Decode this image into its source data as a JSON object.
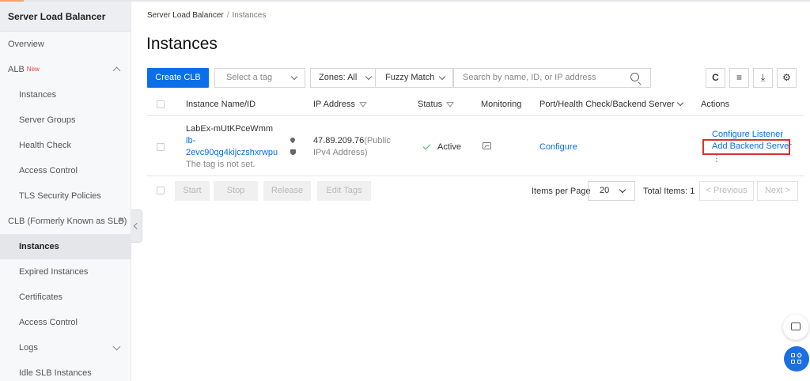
{
  "sidebar": {
    "title": "Server Load Balancer",
    "overview": "Overview",
    "alb": {
      "label": "ALB",
      "badge": "New"
    },
    "alb_items": [
      "Instances",
      "Server Groups",
      "Health Check",
      "Access Control",
      "TLS Security Policies"
    ],
    "clb": {
      "label": "CLB (Formerly Known as SLB)"
    },
    "clb_items": [
      "Instances",
      "Expired Instances",
      "Certificates",
      "Access Control",
      "Logs",
      "Idle SLB Instances"
    ]
  },
  "breadcrumb": {
    "root": "Server Load Balancer",
    "separator": "/",
    "current": "Instances"
  },
  "page": {
    "title": "Instances"
  },
  "toolbar": {
    "create_label": "Create CLB",
    "tag_select": "Select a tag",
    "zones_select": "Zones: All",
    "match_select": "Fuzzy Match",
    "search_placeholder": "Search by name, ID, or IP address",
    "refresh_icon": "C",
    "list_icon": "≡",
    "download_icon": "⤓",
    "settings_icon": "⚙"
  },
  "table": {
    "headers": {
      "name": "Instance Name/ID",
      "ip": "IP Address",
      "status": "Status",
      "monitoring": "Monitoring",
      "port": "Port/Health Check/Backend Server",
      "actions": "Actions"
    },
    "rows": [
      {
        "name": "LabEx-mUtKPceWmm",
        "id_line1": "lb-",
        "id_line2": "2evc90qg4kijczshxrwpu",
        "tag_note": "The tag is not set.",
        "ip": "47.89.209.76",
        "ip_type_1": "(Public",
        "ip_type_2": "IPv4 Address)",
        "status": "Active",
        "configure": "Configure",
        "action_configure_listener": "Configure Listener",
        "action_add_backend": "Add Backend Server",
        "action_separator": "|",
        "more": "⋮"
      }
    ]
  },
  "footer": {
    "start": "Start",
    "stop": "Stop",
    "release": "Release",
    "edit_tags": "Edit Tags",
    "items_per_page_label": "Items per Page",
    "items_per_page": "20",
    "total": "Total Items: 1",
    "previous": "Previous",
    "next": "Next",
    "previous_arrow": "<",
    "next_arrow": ">"
  },
  "colors": {
    "primary": "#0a6fe8",
    "active_status": "#3fb46a",
    "highlight": "#d9322d",
    "new_badge": "#e54545"
  }
}
